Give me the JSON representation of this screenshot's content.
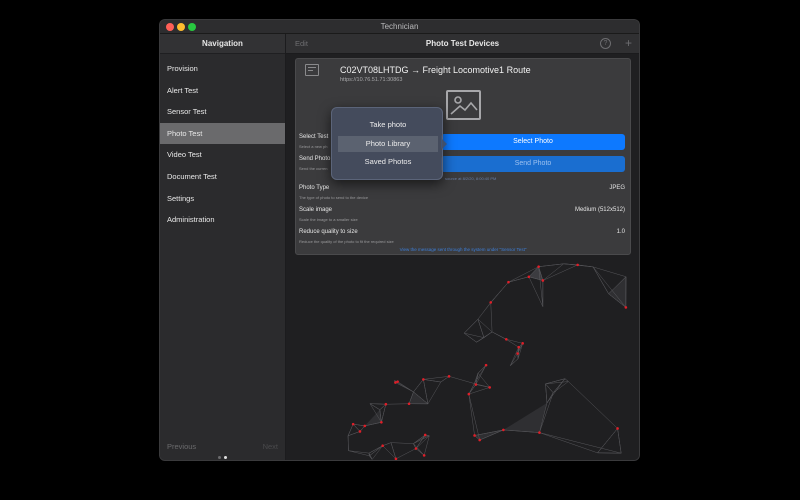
{
  "window": {
    "title": "Technician"
  },
  "sidebar": {
    "header": "Navigation",
    "items": [
      {
        "label": "Provision"
      },
      {
        "label": "Alert Test"
      },
      {
        "label": "Sensor Test"
      },
      {
        "label": "Photo Test"
      },
      {
        "label": "Video Test"
      },
      {
        "label": "Document Test"
      },
      {
        "label": "Settings"
      },
      {
        "label": "Administration"
      }
    ],
    "selected_index": 3,
    "footer": {
      "previous": "Previous",
      "next": "Next",
      "page_index": 1,
      "page_count": 2
    }
  },
  "main": {
    "edit_label": "Edit",
    "title": "Photo Test Devices",
    "help_icon": "question-circle-icon",
    "add_icon": "plus-icon",
    "device": {
      "title": "C02VT08LHTDG → Freight Locomotive1 Route",
      "url": "https://10.76.51.71:30863"
    },
    "rows": {
      "select_test": {
        "label": "Select Test",
        "sub": "Select a new ph"
      },
      "send_photo": {
        "label": "Send Photo",
        "sub": "Send the curren"
      },
      "photo_type": {
        "label": "Photo Type",
        "sub": "The type of photo to send to the device",
        "value": "JPEG"
      },
      "scale_image": {
        "label": "Scale image",
        "sub": "Scale the image to a smaller size",
        "value": "Medium (512x512)"
      },
      "reduce_quality": {
        "label": "Reduce quality to size",
        "sub": "Reduce the quality of the photo to fit the required size",
        "value": "1.0"
      }
    },
    "select_photo_button": "Select Photo",
    "send_photo_button": "Send Photo",
    "send_note": "source at 8/2/20, 8:00:40 PM",
    "bottom_link": "View the message sent through the system under \"Sensor Test\"",
    "colors": {
      "accent": "#0d79ff",
      "network_node": "#e01e28"
    }
  },
  "popover": {
    "items": [
      {
        "label": "Take photo"
      },
      {
        "label": "Photo Library"
      },
      {
        "label": "Saved Photos"
      }
    ],
    "selected_index": 1
  }
}
